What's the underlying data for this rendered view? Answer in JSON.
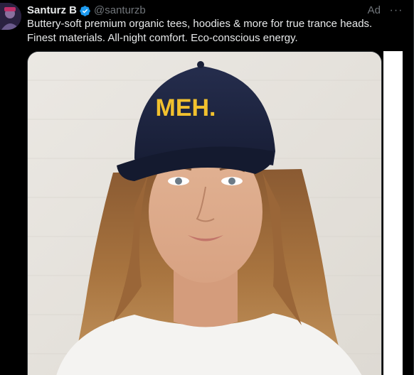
{
  "post": {
    "author_name": "Santurz B",
    "handle": "@santurzb",
    "ad_label": "Ad",
    "more_icon": "more-horizontal-icon",
    "verified_icon": "verified-badge-icon",
    "text": "Buttery-soft premium organic tees, hoodies & more for true trance heads. Finest materials. All-night comfort. Eco-conscious energy.",
    "media": {
      "hat_text": "MEH.",
      "hat_color": "#1d2440",
      "hat_text_color": "#f2c12e"
    }
  },
  "colors": {
    "background": "#000000",
    "text_primary": "#e7e9ea",
    "text_secondary": "#71767b",
    "verified_blue": "#1d9bf0"
  }
}
